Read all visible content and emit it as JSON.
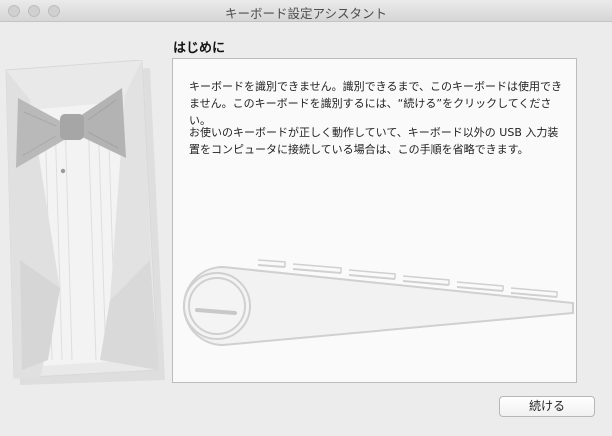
{
  "window": {
    "title": "キーボード設定アシスタント"
  },
  "main": {
    "heading": "はじめに",
    "paragraph1": "キーボードを識別できません。識別できるまで、このキーボードは使用できません。このキーボードを識別するには、“続ける”をクリックしてください。",
    "paragraph2": "お使いのキーボードが正しく動作していて、キーボード以外の USB 入力装置をコンピュータに接続している場合は、この手順を省略できます。"
  },
  "footer": {
    "continue_label": "続ける"
  },
  "icons": {
    "illustration": "tuxedo-bowtie-illustration-icon",
    "keyboard": "keyboard-outline-icon"
  }
}
